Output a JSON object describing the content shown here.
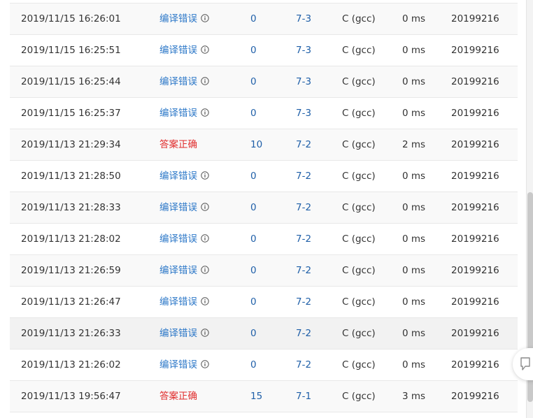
{
  "submissions": [
    {
      "time": "2019/11/15 16:26:01",
      "status": "编译错误",
      "status_kind": "err",
      "score": "0",
      "problem": "7-3",
      "compiler": "C (gcc)",
      "duration": "0 ms",
      "user": "20199216"
    },
    {
      "time": "2019/11/15 16:25:51",
      "status": "编译错误",
      "status_kind": "err",
      "score": "0",
      "problem": "7-3",
      "compiler": "C (gcc)",
      "duration": "0 ms",
      "user": "20199216"
    },
    {
      "time": "2019/11/15 16:25:44",
      "status": "编译错误",
      "status_kind": "err",
      "score": "0",
      "problem": "7-3",
      "compiler": "C (gcc)",
      "duration": "0 ms",
      "user": "20199216"
    },
    {
      "time": "2019/11/15 16:25:37",
      "status": "编译错误",
      "status_kind": "err",
      "score": "0",
      "problem": "7-3",
      "compiler": "C (gcc)",
      "duration": "0 ms",
      "user": "20199216"
    },
    {
      "time": "2019/11/13 21:29:34",
      "status": "答案正确",
      "status_kind": "ok",
      "score": "10",
      "problem": "7-2",
      "compiler": "C (gcc)",
      "duration": "2 ms",
      "user": "20199216"
    },
    {
      "time": "2019/11/13 21:28:50",
      "status": "编译错误",
      "status_kind": "err",
      "score": "0",
      "problem": "7-2",
      "compiler": "C (gcc)",
      "duration": "0 ms",
      "user": "20199216"
    },
    {
      "time": "2019/11/13 21:28:33",
      "status": "编译错误",
      "status_kind": "err",
      "score": "0",
      "problem": "7-2",
      "compiler": "C (gcc)",
      "duration": "0 ms",
      "user": "20199216"
    },
    {
      "time": "2019/11/13 21:28:02",
      "status": "编译错误",
      "status_kind": "err",
      "score": "0",
      "problem": "7-2",
      "compiler": "C (gcc)",
      "duration": "0 ms",
      "user": "20199216"
    },
    {
      "time": "2019/11/13 21:26:59",
      "status": "编译错误",
      "status_kind": "err",
      "score": "0",
      "problem": "7-2",
      "compiler": "C (gcc)",
      "duration": "0 ms",
      "user": "20199216"
    },
    {
      "time": "2019/11/13 21:26:47",
      "status": "编译错误",
      "status_kind": "err",
      "score": "0",
      "problem": "7-2",
      "compiler": "C (gcc)",
      "duration": "0 ms",
      "user": "20199216"
    },
    {
      "time": "2019/11/13 21:26:33",
      "status": "编译错误",
      "status_kind": "err",
      "score": "0",
      "problem": "7-2",
      "compiler": "C (gcc)",
      "duration": "0 ms",
      "user": "20199216"
    },
    {
      "time": "2019/11/13 21:26:02",
      "status": "编译错误",
      "status_kind": "err",
      "score": "0",
      "problem": "7-2",
      "compiler": "C (gcc)",
      "duration": "0 ms",
      "user": "20199216"
    },
    {
      "time": "2019/11/13 19:56:47",
      "status": "答案正确",
      "status_kind": "ok",
      "score": "15",
      "problem": "7-1",
      "compiler": "C (gcc)",
      "duration": "3 ms",
      "user": "20199216"
    }
  ],
  "colors": {
    "error_status": "#2d78c8",
    "accepted_status": "#e02c2c",
    "link": "#1f5fa8",
    "text": "#333333"
  },
  "icons": {
    "status_info": "info-circle-icon",
    "feedback": "feedback-icon"
  }
}
